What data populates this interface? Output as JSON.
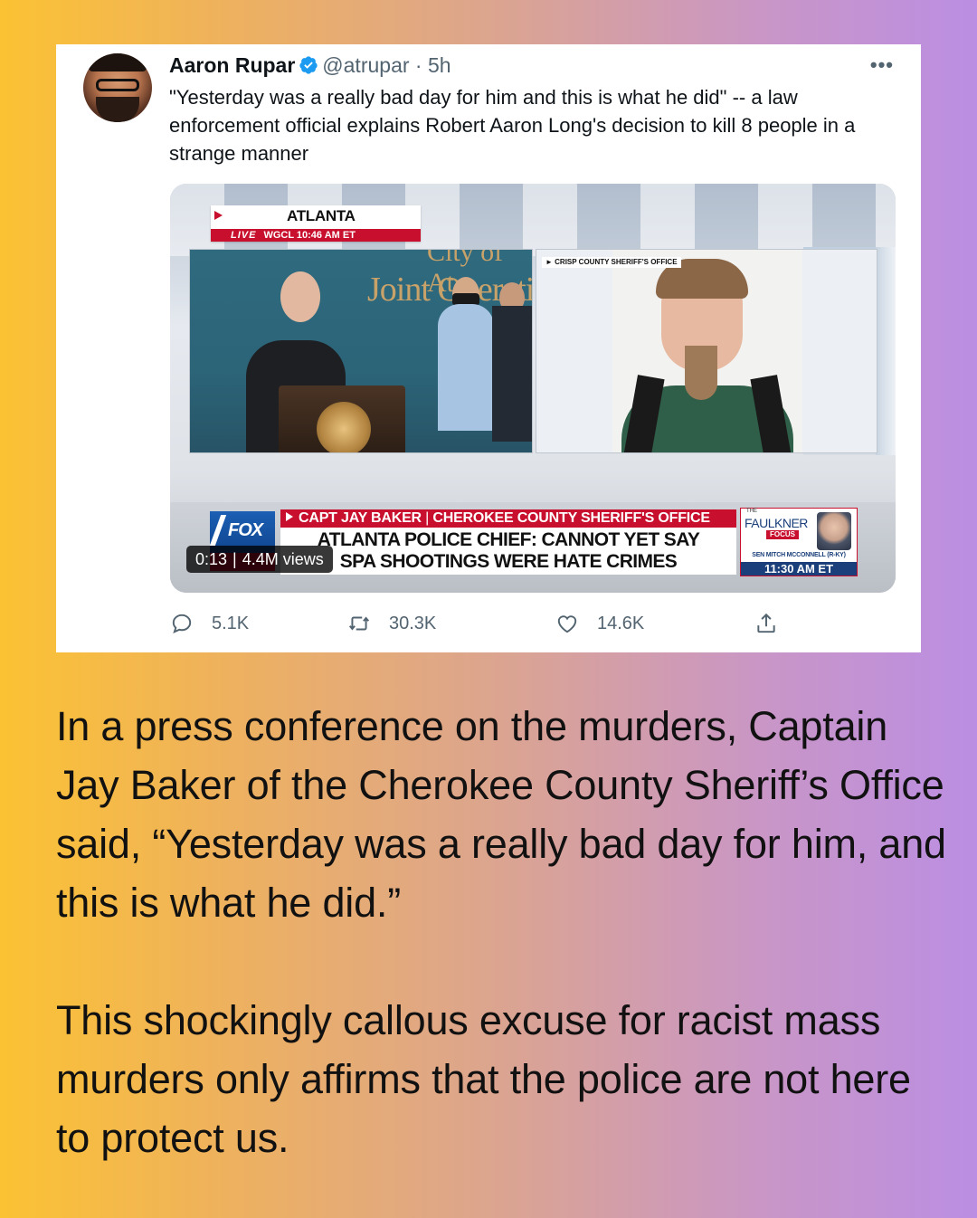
{
  "tweet": {
    "author_name": "Aaron Rupar",
    "handle": "@atrupar",
    "time_ago": "5h",
    "text": "\"Yesterday was a really bad day for him and this is what he did\" -- a law enforcement official explains Robert Aaron Long's decision to kill 8 people in a strange manner",
    "more_icon": "more-icon",
    "verified_icon": "verified-badge-icon",
    "verified_color": "#1d9bf0",
    "actions": {
      "reply_count": "5.1K",
      "retweet_count": "30.3K",
      "like_count": "14.6K",
      "share_icon": "share-icon"
    }
  },
  "video": {
    "location_city": "ATLANTA",
    "location_live": "LIVE",
    "location_info": "WGCL   10:46 AM ET",
    "wall_text_top": "City of At",
    "wall_text": "Joint Operation",
    "right_feed_label": "CRISP COUNTY SHERIFF'S OFFICE",
    "network_logo": "FOX",
    "chyron_speaker": "CAPT JAY BAKER",
    "chyron_separator": "|",
    "chyron_title": "CHEROKEE COUNTY SHERIFF'S OFFICE",
    "chyron_line1": "ATLANTA POLICE CHIEF: CANNOT YET SAY",
    "chyron_line2": "SPA SHOOTINGS WERE HATE CRIMES",
    "show_the": "THE",
    "show_name": "FAULKNER",
    "show_focus": "FOCUS",
    "show_guest": "SEN MITCH MCCONNELL (R-KY)",
    "show_time": "11:30 AM ET",
    "duration": "0:13",
    "views": "4.4M views",
    "accent_red": "#c8102e",
    "accent_blue": "#1a3f7a"
  },
  "caption": {
    "paragraph1": "In a press conference on the murders, Captain Jay Baker of the Cherokee County Sheriff’s Office said, “Yesterday was a really bad day for him, and this is what he did.”",
    "paragraph2": "This shockingly callous excuse for racist mass murders only affirms that the police are not here to protect us."
  },
  "colors": {
    "gradient_left": "#fbc233",
    "gradient_right": "#bb8ee3"
  }
}
